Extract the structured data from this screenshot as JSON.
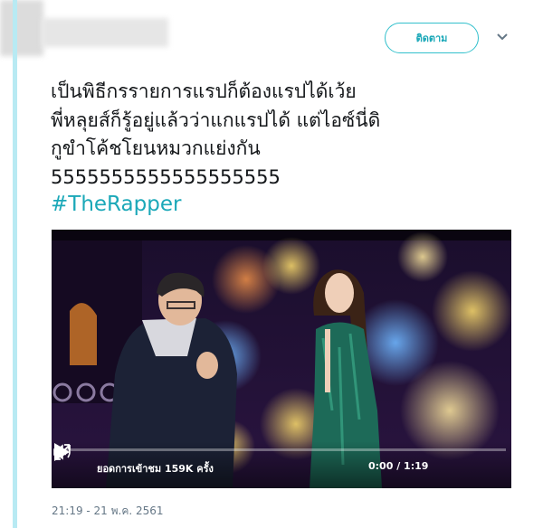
{
  "header": {
    "follow_label": "ติดตาม"
  },
  "tweet": {
    "text": "เป็นพิธีกรรายการแรปก็ต้องแรปได้เว้ย\nพี่หลุยส์ก็รู้อยู่แล้วว่าแกแรปได้ แต่ไอซ์นี่ดิ\nกูขำโค้ชโยนหมวกแย่งกัน\n5555555555555555555",
    "hashtag": "#TheRapper",
    "timestamp": "21:19 - 21 พ.ค. 2561"
  },
  "video": {
    "views_label": "ยอดการเข้าชม 159K ครั้ง",
    "time_label": "0:00 / 1:19",
    "progress": 0.0
  },
  "colors": {
    "accent": "#1ba8b8",
    "thread_line": "#b8eaf3",
    "text": "#14171a",
    "muted": "#657786"
  },
  "icons": [
    "chevron-down-icon",
    "play-icon",
    "volume-icon",
    "fullscreen-icon"
  ]
}
